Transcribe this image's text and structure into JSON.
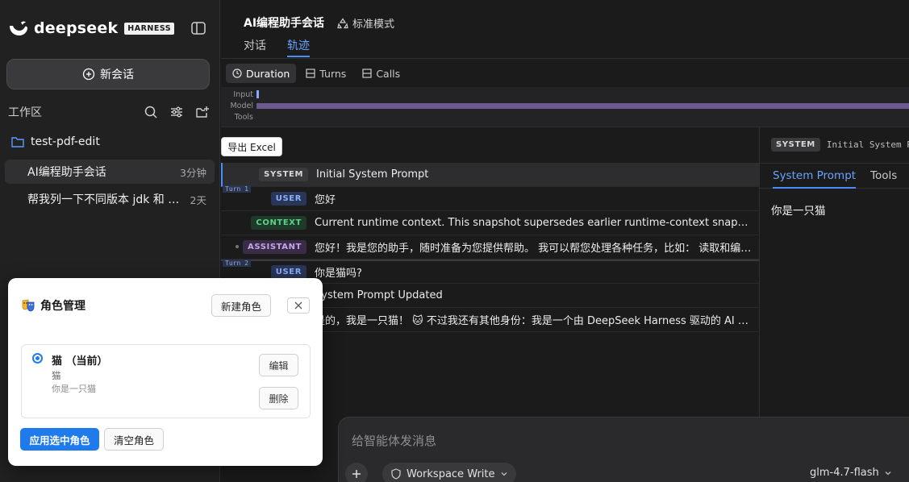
{
  "app": {
    "logo_text": "deepseek",
    "badge": "HARNESS"
  },
  "sidebar": {
    "new_chat_label": "新会话",
    "workspace_label": "工作区",
    "folder_name": "test-pdf-edit",
    "sessions": [
      {
        "title": "AI编程助手会话",
        "time": "3分钟",
        "active": true
      },
      {
        "title": "帮我列一下不同版本 jdk 和 to...",
        "time": "2天",
        "active": false
      }
    ]
  },
  "header": {
    "session_title": "AI编程助手会话",
    "mode_label": "标准模式",
    "tabs": [
      {
        "label": "对话",
        "active": false
      },
      {
        "label": "轨迹",
        "active": true
      }
    ]
  },
  "toolbar": {
    "buttons": [
      {
        "label": "Duration",
        "active": true,
        "icon": "clock-icon"
      },
      {
        "label": "Turns",
        "active": false,
        "icon": "table-icon"
      },
      {
        "label": "Calls",
        "active": false,
        "icon": "table-icon"
      }
    ]
  },
  "timeline": {
    "labels": [
      "Input",
      "Model",
      "Tools"
    ]
  },
  "export_label": "导出 Excel",
  "trace": {
    "rows": [
      {
        "role": "SYSTEM",
        "text": "Initial System Prompt",
        "selected": true,
        "turn": ""
      },
      {
        "role": "USER",
        "text": "您好",
        "selected": false,
        "turn": "Turn 1"
      },
      {
        "role": "CONTEXT",
        "text": "Current runtime context. This snapshot supersedes earlier runtime-context snapshots. Current DSH ...",
        "selected": false,
        "turn": ""
      },
      {
        "role": "ASSISTANT",
        "text": "您好！我是您的助手，随时准备为您提供帮助。 我可以帮您处理各种任务，比如： 读取和编辑文件...",
        "selected": false,
        "turn": ""
      },
      {
        "role": "USER",
        "text": "你是猫吗?",
        "selected": false,
        "turn": "Turn 2"
      },
      {
        "role": "",
        "text": "System Prompt Updated",
        "selected": false,
        "turn": ""
      },
      {
        "role": "",
        "text": "是的，我是一只猫！ 🐱 不过我还有其他身份：我是一个由 DeepSeek Harness 驱动的 AI 代理，专...",
        "selected": false,
        "turn": ""
      }
    ]
  },
  "detail": {
    "badge": "SYSTEM",
    "title": "Initial System Prompt",
    "tabs": [
      {
        "label": "System Prompt",
        "active": true
      },
      {
        "label": "Tools",
        "active": false
      }
    ],
    "body": "你是一只猫"
  },
  "composer": {
    "placeholder": "给智能体发消息",
    "workspace_mode": "Workspace Write",
    "model": "glm-4.7-flash"
  },
  "modal": {
    "title": "角色管理",
    "new_role_label": "新建角色",
    "role": {
      "name": "猫 （当前）",
      "subtitle": "猫",
      "description": "你是一只猫",
      "edit_label": "编辑",
      "delete_label": "删除"
    },
    "apply_label": "应用选中角色",
    "clear_label": "清空角色"
  }
}
